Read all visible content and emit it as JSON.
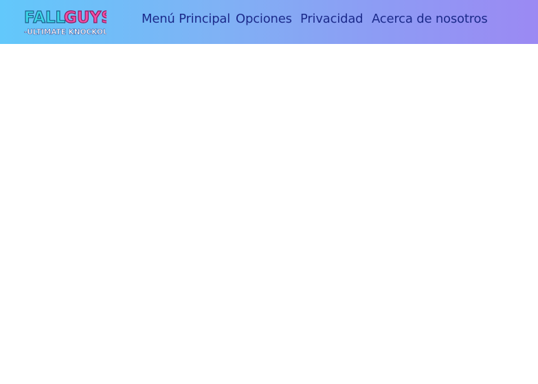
{
  "header": {
    "logo": {
      "line1_left": "FALL",
      "line1_right": "GUYS",
      "line2": "-ULTIMATE KNOCKOUT-"
    },
    "nav": [
      {
        "label": "Menú Principal"
      },
      {
        "label": "Opciones"
      },
      {
        "label": "Privacidad"
      },
      {
        "label": "Acerca de nosotros"
      }
    ]
  },
  "colors": {
    "header_gradient_start": "#62c8fb",
    "header_gradient_end": "#9b89f3",
    "nav_text": "#1b2a8a",
    "logo_fall": "#3dd6e8",
    "logo_guys": "#f24fa6"
  }
}
